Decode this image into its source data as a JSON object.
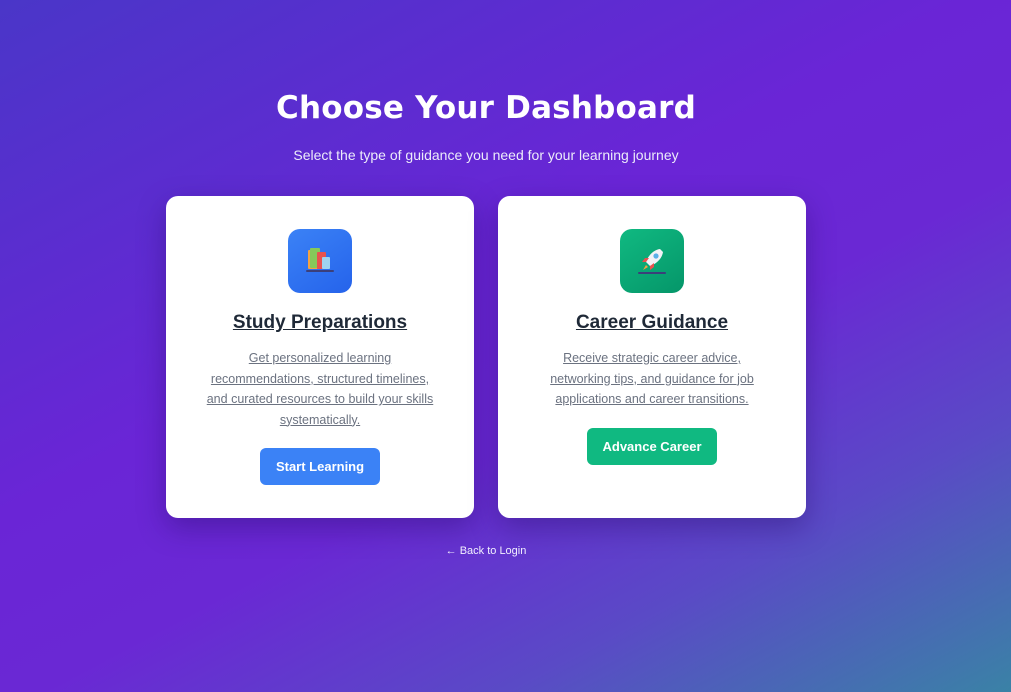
{
  "header": {
    "title": "Choose Your Dashboard",
    "subtitle": "Select the type of guidance you need for your learning journey"
  },
  "cards": [
    {
      "title": "Study Preparations",
      "description": "Get personalized learning recommendations, structured timelines, and curated resources to build your skills systematically.",
      "button_label": "Start Learning",
      "icon": "books-icon",
      "accent_color": "#3b82f6"
    },
    {
      "title": "Career Guidance",
      "description": "Receive strategic career advice, networking tips, and guidance for job applications and career transitions.",
      "button_label": "Advance Career",
      "icon": "rocket-icon",
      "accent_color": "#10b981"
    }
  ],
  "footer": {
    "back_link": "← Back to Login"
  },
  "colors": {
    "background_start": "#4a36c8",
    "background_mid": "#6a25d6",
    "background_end": "#3a82a6",
    "card_background": "#ffffff",
    "title_text": "#1f2937",
    "body_text": "#6b7280"
  }
}
